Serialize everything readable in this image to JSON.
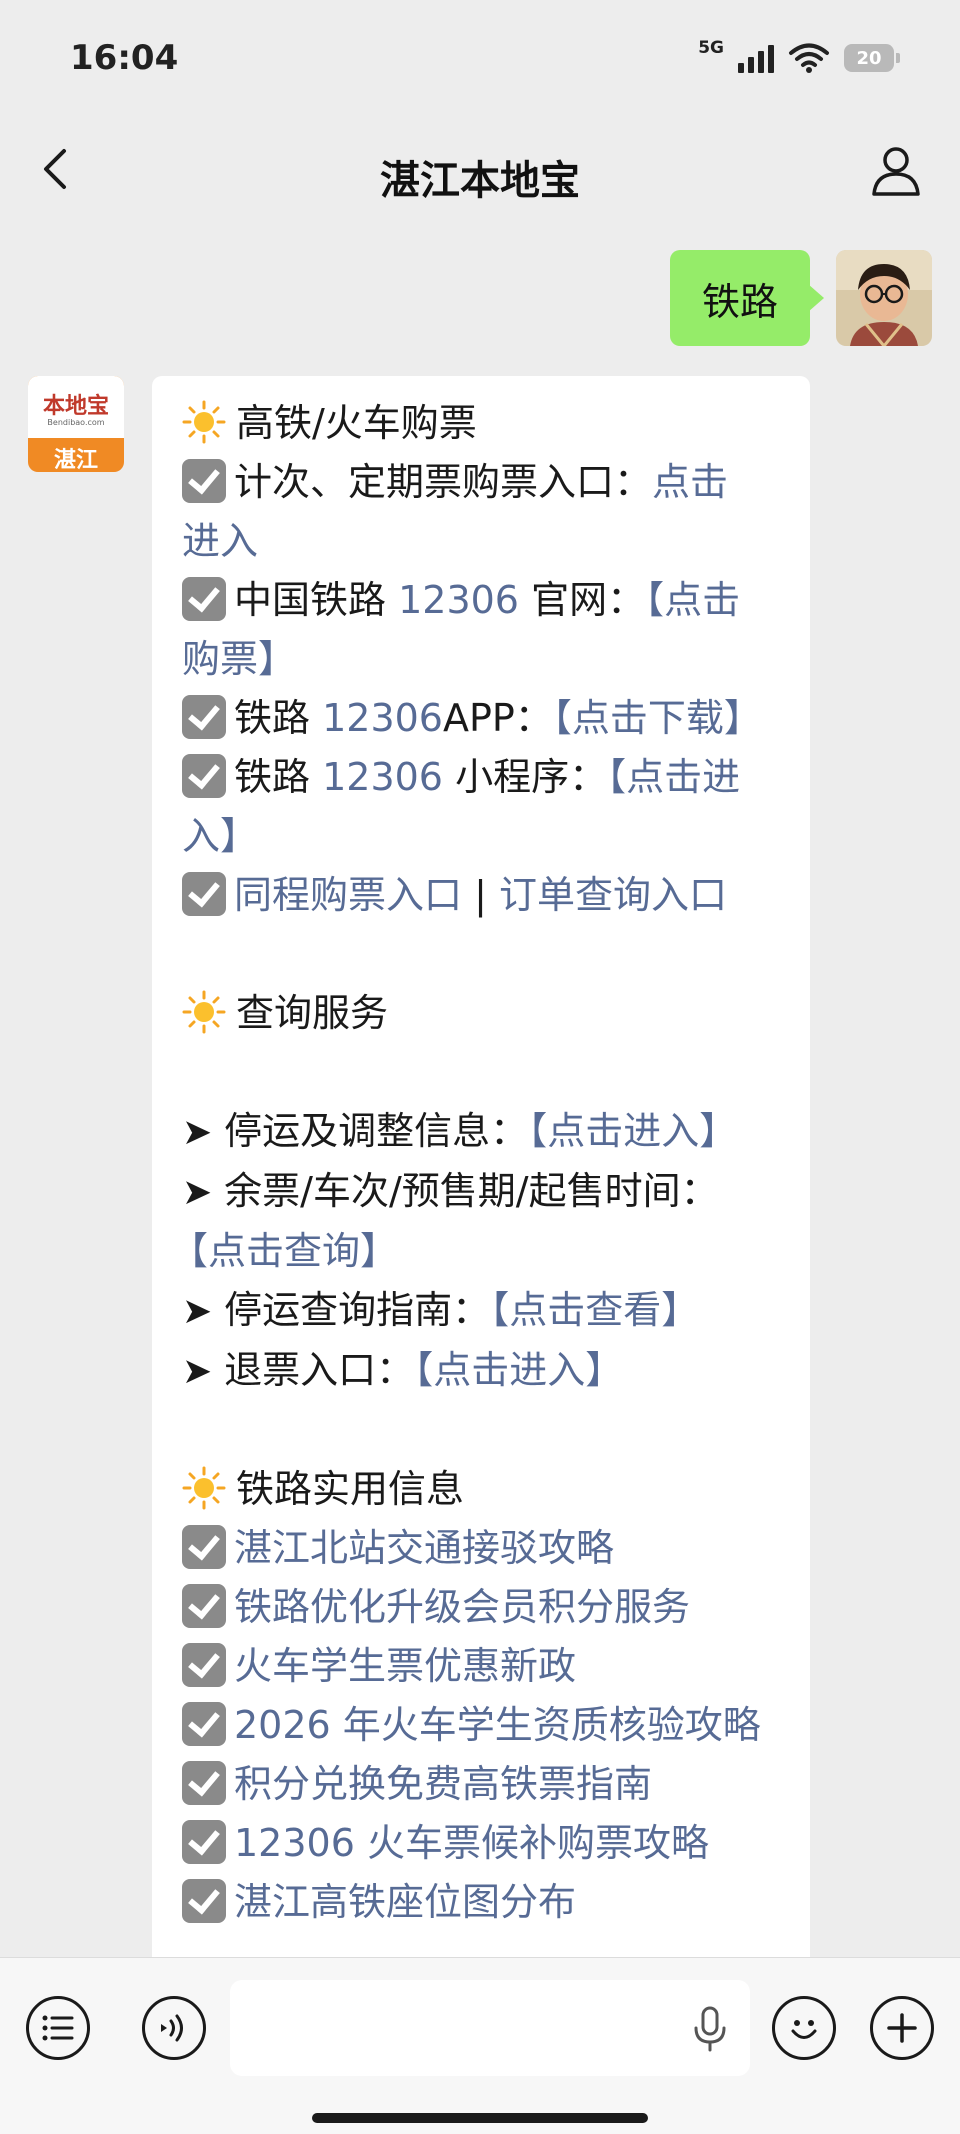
{
  "status_bar": {
    "time": "16:04",
    "network": "5G",
    "battery": "20"
  },
  "nav": {
    "title": "湛江本地宝",
    "back_icon": "chevron-left-icon",
    "profile_icon": "person-icon"
  },
  "user_message": {
    "text": "铁路"
  },
  "bot": {
    "avatar_logo": "本地宝",
    "avatar_url": "Bendibao.com",
    "avatar_city": "湛江"
  },
  "sections": {
    "s1_title": "高铁/火车购票",
    "r1_text": "计次、定期票购票入口：",
    "r1_link_a": "点击",
    "r1_link_b": "进入",
    "r2_text_a": "中国铁路 ",
    "r2_num": "12306",
    "r2_text_b": " 官网：",
    "r2_link_a": "【点击",
    "r2_link_b": "购票】",
    "r3_text_a": "铁路 ",
    "r3_num": "12306",
    "r3_text_b": "APP：",
    "r3_link": "【点击下载】",
    "r4_text_a": "铁路 ",
    "r4_num": "12306",
    "r4_text_b": " 小程序：",
    "r4_link_a": "【点击进",
    "r4_link_b": "入】",
    "r5_link_a": "同程购票入口",
    "r5_sep": " | ",
    "r5_link_b": "订单查询入口",
    "s2_title": "查询服务",
    "q1_text": "停运及调整信息：",
    "q1_link": "【点击进入】",
    "q2_text": "余票/车次/预售期/起售时间：",
    "q2_link": "【点击查询】",
    "q3_text": "停运查询指南：",
    "q3_link": "【点击查看】",
    "q4_text": "退票入口：",
    "q4_link": "【点击进入】",
    "s3_title": "铁路实用信息",
    "info": [
      "湛江北站交通接驳攻略",
      "铁路优化升级会员积分服务",
      "火车学生票优惠新政",
      "2026 年火车学生资质核验攻略",
      "积分兑换免费高铁票指南",
      "12306 火车票候补购票攻略",
      "湛江高铁座位图分布"
    ]
  },
  "colors": {
    "link": "#576b95",
    "user_bubble": "#95ec69",
    "background": "#ededed"
  }
}
